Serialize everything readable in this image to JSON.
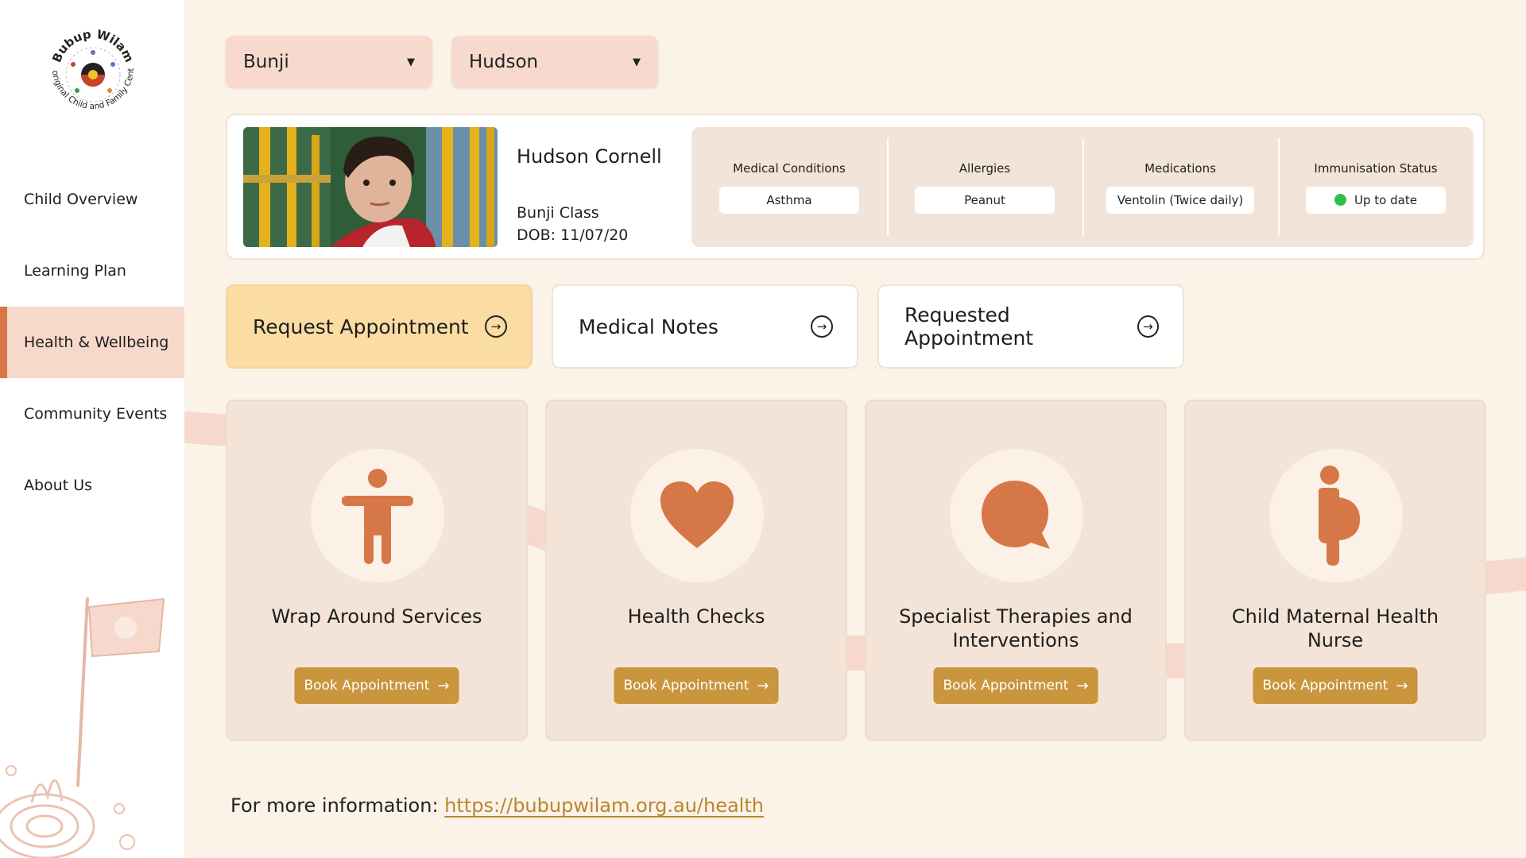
{
  "logo": {
    "arc_top": "Bubup Wilam",
    "arc_bottom": "Aboriginal Child and Family Centre"
  },
  "sidebar": {
    "items": [
      {
        "label": "Child Overview",
        "active": false
      },
      {
        "label": "Learning Plan",
        "active": false
      },
      {
        "label": "Health & Wellbeing",
        "active": true
      },
      {
        "label": "Community Events",
        "active": false
      },
      {
        "label": "About Us",
        "active": false
      }
    ]
  },
  "filters": {
    "class_select": "Bunji",
    "child_select": "Hudson"
  },
  "profile": {
    "name": "Hudson Cornell",
    "class": "Bunji Class",
    "dob": "DOB: 11/07/20",
    "stats": [
      {
        "label": "Medical Conditions",
        "value": "Asthma"
      },
      {
        "label": "Allergies",
        "value": "Peanut"
      },
      {
        "label": "Medications",
        "value": "Ventolin (Twice daily)"
      },
      {
        "label": "Immunisation Status",
        "value": "Up to date",
        "status_color": "#2fbf4a"
      }
    ]
  },
  "actions": [
    {
      "label": "Request Appointment",
      "primary": true
    },
    {
      "label": "Medical Notes",
      "primary": false
    },
    {
      "label": "Requested Appointment",
      "primary": false
    }
  ],
  "services": [
    {
      "title": "Wrap Around Services",
      "icon": "accessibility-person-icon",
      "button": "Book Appointment"
    },
    {
      "title": "Health Checks",
      "icon": "heart-icon",
      "button": "Book Appointment"
    },
    {
      "title": "Specialist Therapies and Interventions",
      "icon": "speech-bubble-icon",
      "button": "Book Appointment"
    },
    {
      "title": "Child Maternal Health Nurse",
      "icon": "pregnant-person-icon",
      "button": "Book Appointment"
    }
  ],
  "footer": {
    "label": "For more information:",
    "link": "https://bubupwilam.org.au/health"
  },
  "colors": {
    "accent": "#d67748",
    "button": "#c9953d",
    "primary_action": "#fbdca3",
    "background": "#fbf2e8"
  }
}
